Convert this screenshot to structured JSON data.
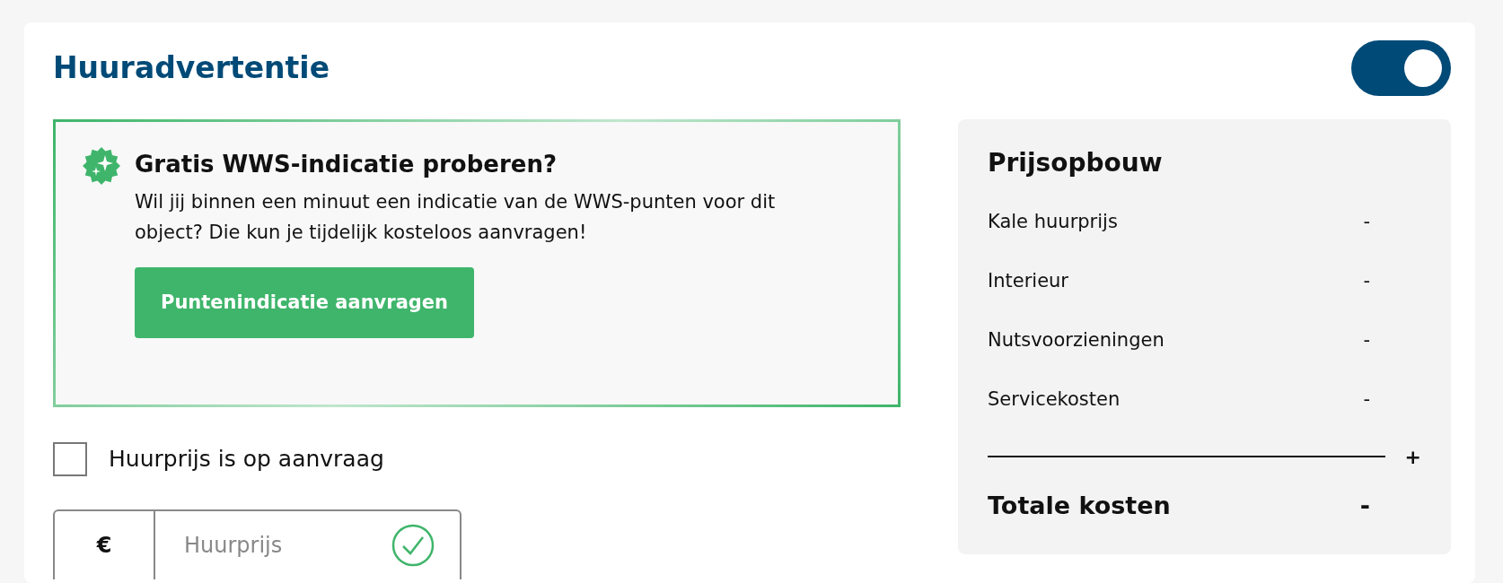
{
  "title": "Huuradvertentie",
  "toggle": {
    "on": true
  },
  "promo": {
    "heading": "Gratis WWS-indicatie proberen?",
    "text": "Wil jij binnen een minuut een indicatie van de WWS-punten voor dit object? Die kun je tijdelijk kosteloos aanvragen!",
    "button": "Puntenindicatie aanvragen"
  },
  "on_request": {
    "label": "Huurprijs is op aanvraag",
    "checked": false
  },
  "price_field": {
    "prefix": "€",
    "placeholder": "Huurprijs",
    "valid": true
  },
  "price_breakdown": {
    "title": "Prijsopbouw",
    "rows": [
      {
        "label": "Kale huurprijs",
        "value": "-"
      },
      {
        "label": "Interieur",
        "value": "-"
      },
      {
        "label": "Nutsvoorzieningen",
        "value": "-"
      },
      {
        "label": "Servicekosten",
        "value": "-"
      }
    ],
    "sum_sign": "+",
    "total_label": "Totale kosten",
    "total_value": "-"
  }
}
